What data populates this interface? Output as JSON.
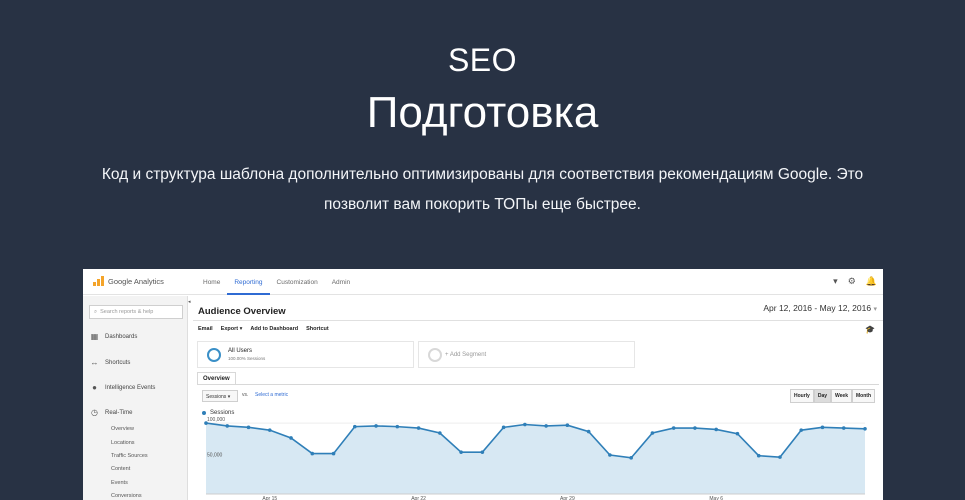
{
  "hero": {
    "kicker": "SEO",
    "title": "Подготовка",
    "description": "Код и структура шаблона дополнительно оптимизированы для соответствия рекомендациям Google. Это позволит вам покорить ТОПы еще быстрее."
  },
  "app": {
    "brand": "Google Analytics",
    "nav": [
      "Home",
      "Reporting",
      "Customization",
      "Admin"
    ],
    "active_nav": "Reporting",
    "top_icons": [
      "chevron-down-icon",
      "gear-icon",
      "bell-icon"
    ]
  },
  "sidebar": {
    "search_placeholder": "Search reports & help",
    "items": [
      {
        "label": "Dashboards",
        "icon": "grid-icon"
      },
      {
        "label": "Shortcuts",
        "icon": "arrows-icon"
      },
      {
        "label": "Intelligence Events",
        "icon": "bulb-icon"
      },
      {
        "label": "Real-Time",
        "icon": "clock-icon"
      }
    ],
    "subitems": [
      "Overview",
      "Locations",
      "Traffic Sources",
      "Content",
      "Events",
      "Conversions"
    ]
  },
  "report": {
    "title": "Audience Overview",
    "date_range": "Apr 12, 2016 - May 12, 2016",
    "toolbar": [
      "Email",
      "Export ▾",
      "Add to Dashboard",
      "Shortcut"
    ],
    "segment_all_users": "All Users",
    "segment_all_users_sub": "100.00% Sessions",
    "segment_add": "+ Add Segment",
    "tab": "Overview",
    "metric": "Sessions",
    "vs": "vs.",
    "select_metric": "Select a metric",
    "granularity": [
      "Hourly",
      "Day",
      "Week",
      "Month"
    ],
    "granularity_selected": "Day",
    "legend": "Sessions"
  },
  "chart_data": {
    "type": "area",
    "series": [
      {
        "name": "Sessions",
        "values": [
          100000,
          96000,
          94000,
          90000,
          79000,
          57000,
          57000,
          95000,
          96000,
          95000,
          93000,
          86000,
          59000,
          59000,
          94000,
          98000,
          96000,
          97000,
          88000,
          55000,
          51000,
          86000,
          93000,
          93000,
          91000,
          85000,
          54000,
          52000,
          90000,
          94000,
          93000,
          92000
        ]
      }
    ],
    "y_tick_labels": [
      "100,000",
      "50,000"
    ],
    "ylim": [
      0,
      110000
    ],
    "x_tick_labels": [
      "Apr 15",
      "Apr 22",
      "Apr 29",
      "May 6"
    ],
    "color": "#2f7fb8",
    "fill": "#d7e8f3"
  }
}
